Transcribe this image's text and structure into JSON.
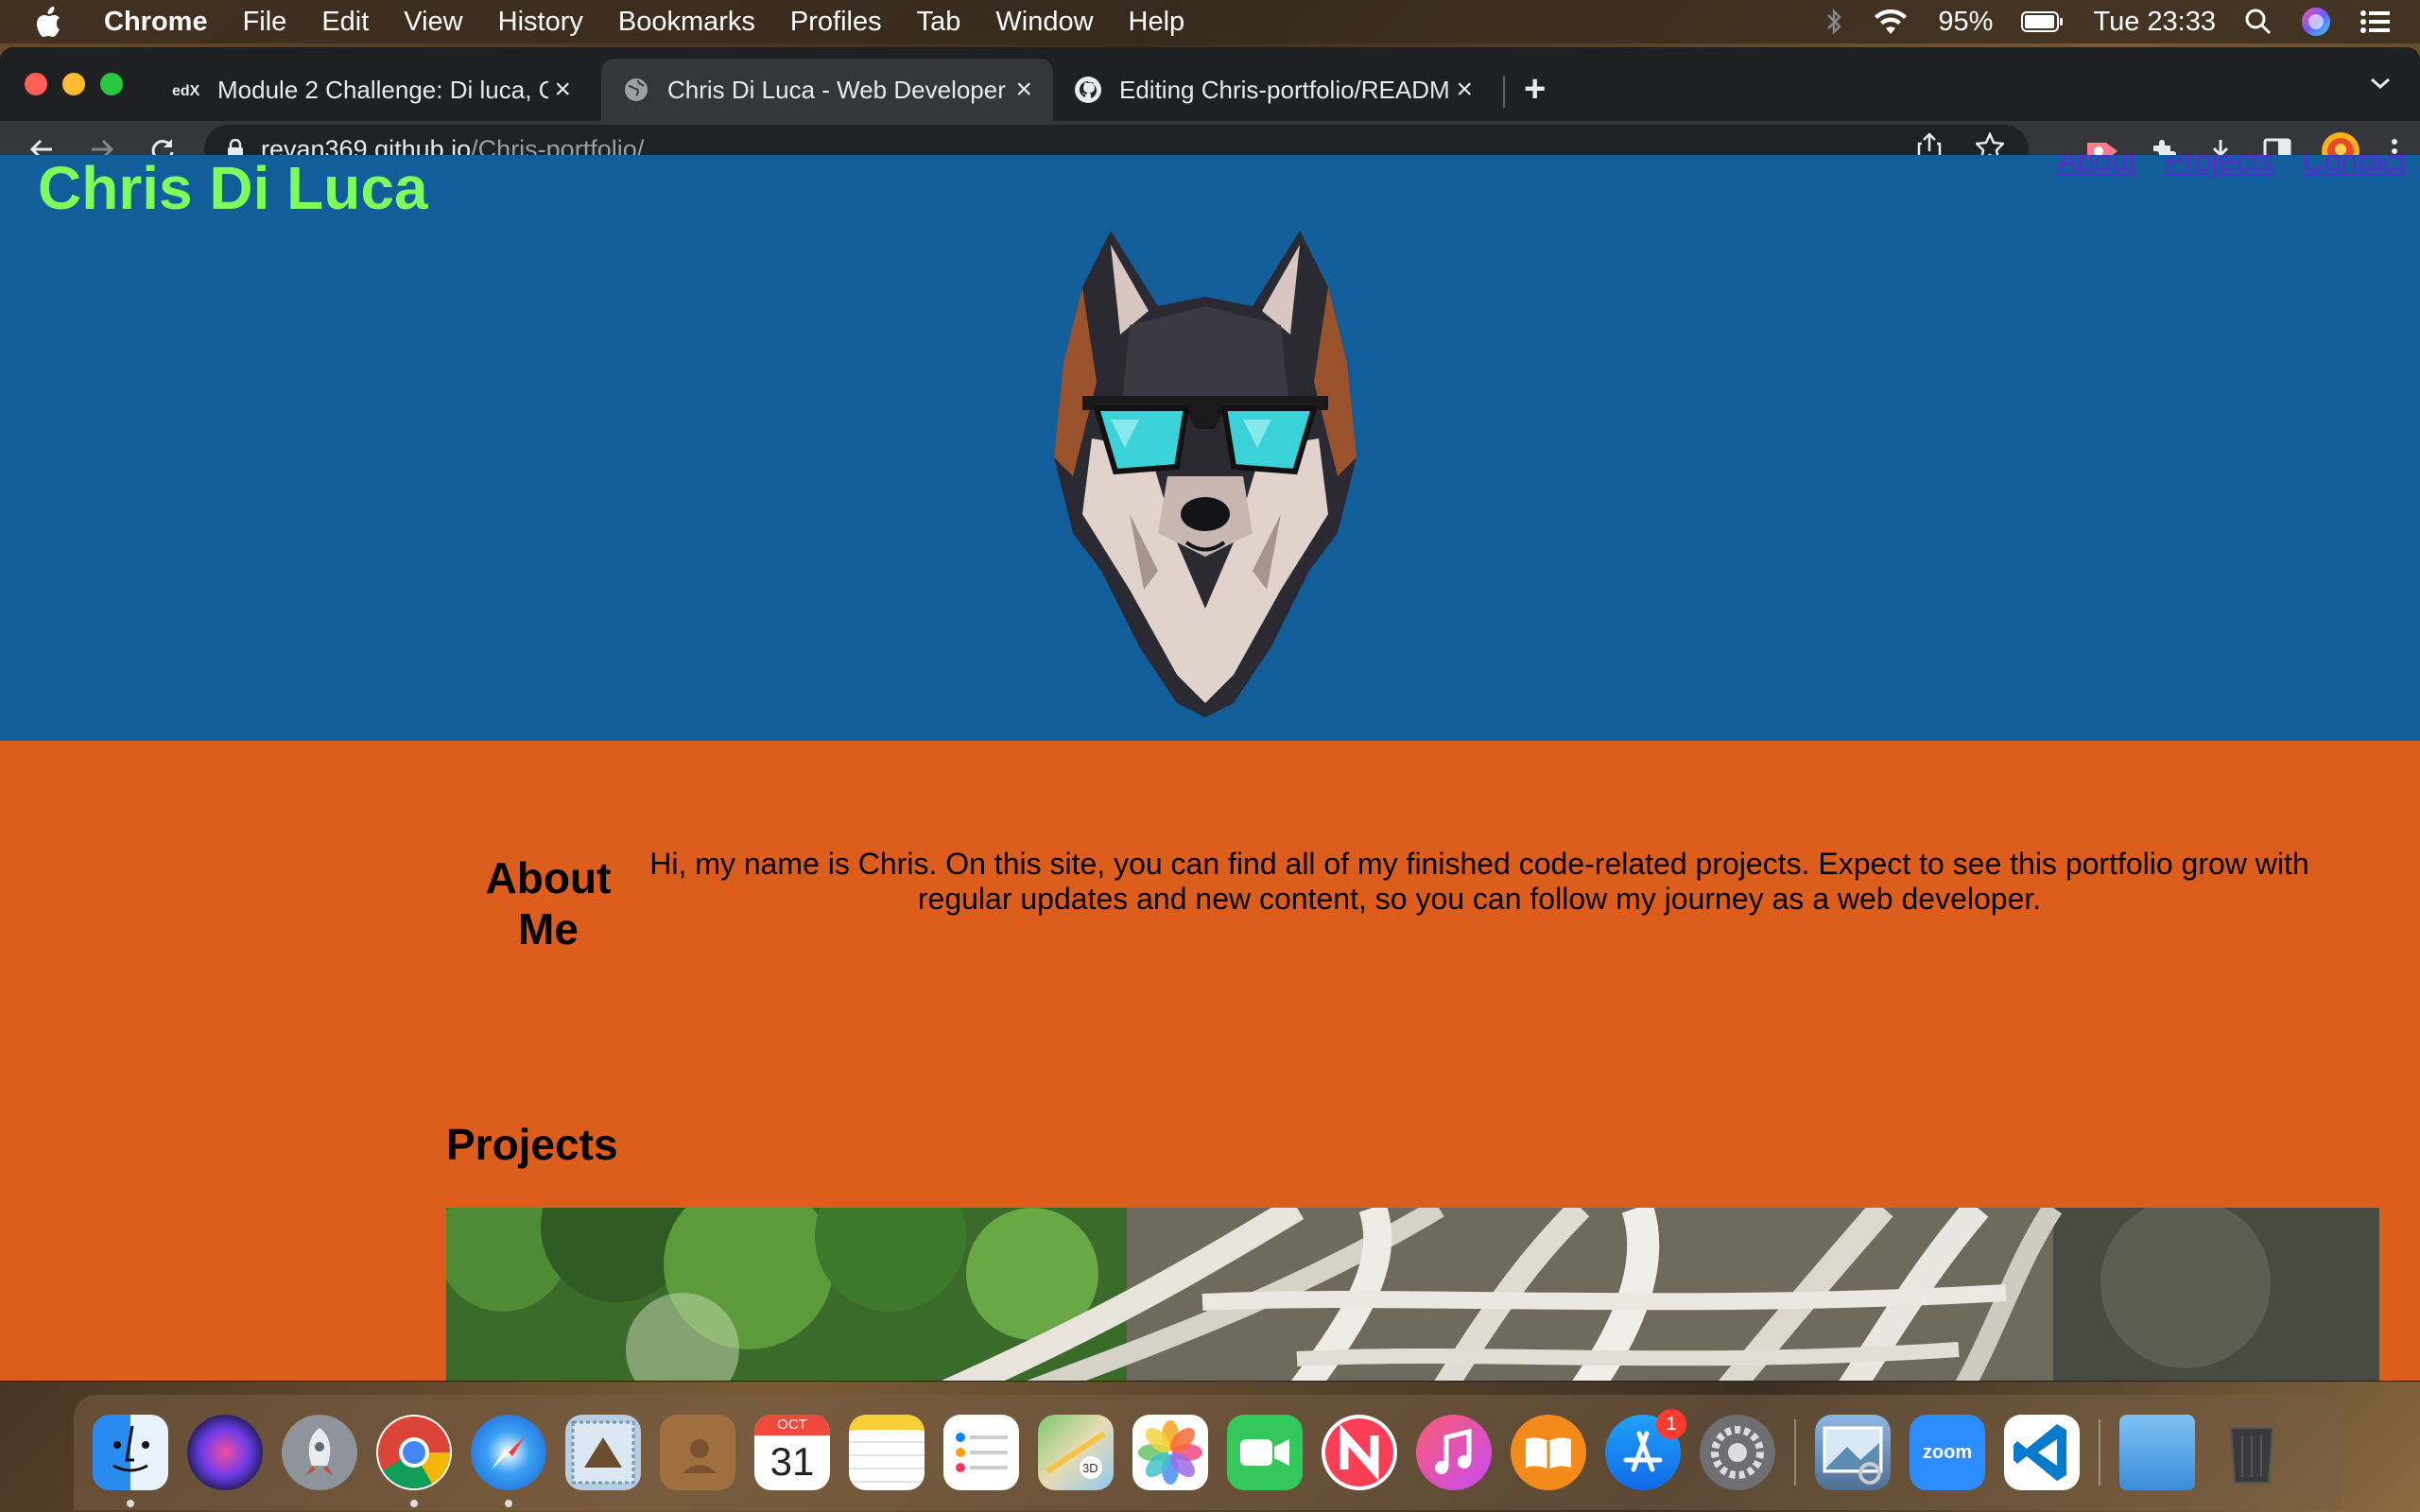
{
  "menubar": {
    "app_name": "Chrome",
    "items": [
      "File",
      "Edit",
      "View",
      "History",
      "Bookmarks",
      "Profiles",
      "Tab",
      "Window",
      "Help"
    ],
    "battery": "95%",
    "clock": "Tue 23:33"
  },
  "browser": {
    "tabs": [
      {
        "title": "Module 2 Challenge: Di luca, C",
        "icon": "edx-icon"
      },
      {
        "title": "Chris Di Luca - Web Developer",
        "icon": "globe-icon"
      },
      {
        "title": "Editing Chris-portfolio/READM",
        "icon": "github-icon"
      }
    ],
    "url_host": "revan369.github.io",
    "url_path": "/Chris-portfolio/"
  },
  "site": {
    "title": "Chris Di Luca",
    "nav": [
      "About",
      "Projects",
      "Contact"
    ],
    "about_heading": "About Me",
    "about_text": "Hi, my name is Chris. On this site, you can find all of my finished code-related projects. Expect to see this portfolio grow with regular updates and new content, so you can follow my journey as a web developer.",
    "projects_heading": "Projects"
  },
  "dock": {
    "calendar_month": "OCT",
    "calendar_day": "31",
    "app_store_badge": "1",
    "zoom_label": "zoom"
  },
  "colors": {
    "hero_bg": "#125e9b",
    "about_bg": "#dd5d1d",
    "title_green": "#7efc5a",
    "nav_link": "#5b2ad0"
  }
}
